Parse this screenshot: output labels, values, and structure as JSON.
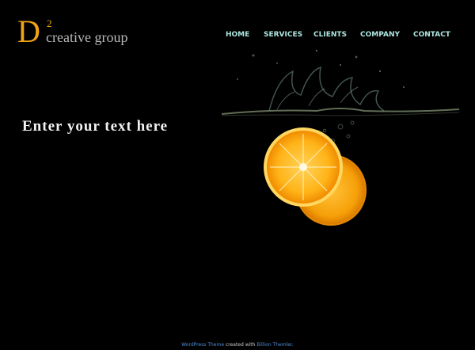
{
  "logo": {
    "letter": "D",
    "superscript": "2",
    "name": "creative group"
  },
  "nav": {
    "items": [
      {
        "label": "HOME"
      },
      {
        "label": "SERVICES"
      },
      {
        "label": "CLIENTS"
      },
      {
        "label": "COMPANY"
      },
      {
        "label": "CONTACT"
      }
    ]
  },
  "hero": {
    "text": "Enter your text here",
    "image": "orange-slices-splash-image"
  },
  "footer": {
    "link1": "WordPress Theme",
    "middle": "created with",
    "link2": "Billion Themler",
    "end": "."
  },
  "colors": {
    "background": "#000000",
    "logo_accent": "#f0a414",
    "nav": "#aee6e0",
    "footer_link": "#4f8cd2"
  }
}
